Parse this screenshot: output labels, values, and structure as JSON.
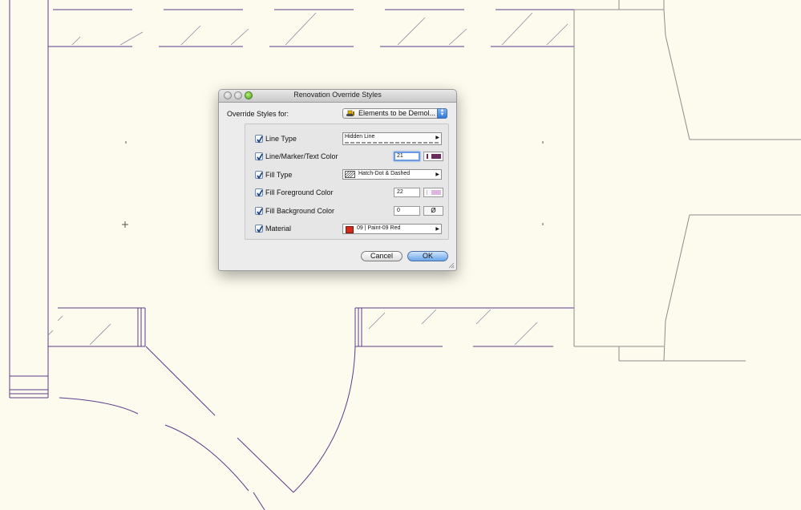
{
  "dialog": {
    "title": "Renovation Override Styles",
    "override_label": "Override Styles for:",
    "override_value": "Elements to be Demol...",
    "rows": [
      {
        "label": "Line Type",
        "checked": true,
        "field_text": "Hidden Line"
      },
      {
        "label": "Line/Marker/Text Color",
        "checked": true,
        "number": "21",
        "swatch_color": "#6a2c5a"
      },
      {
        "label": "Fill Type",
        "checked": true,
        "field_text": "Hatch-Dot & Dashed"
      },
      {
        "label": "Fill Foreground Color",
        "checked": true,
        "number": "22",
        "swatch_color": "#d9b6dc"
      },
      {
        "label": "Fill Background Color",
        "checked": true,
        "number": "0",
        "swatch_symbol": "Ø"
      },
      {
        "label": "Material",
        "checked": true,
        "field_text": "09 | Paint-09 Red",
        "material_color": "#d22a1b"
      }
    ],
    "cancel_label": "Cancel",
    "ok_label": "OK"
  },
  "colors": {
    "canvas_background": "#fdfbed",
    "plan_line": "#5a3b8c",
    "ok_button": "#6aa5ea"
  }
}
